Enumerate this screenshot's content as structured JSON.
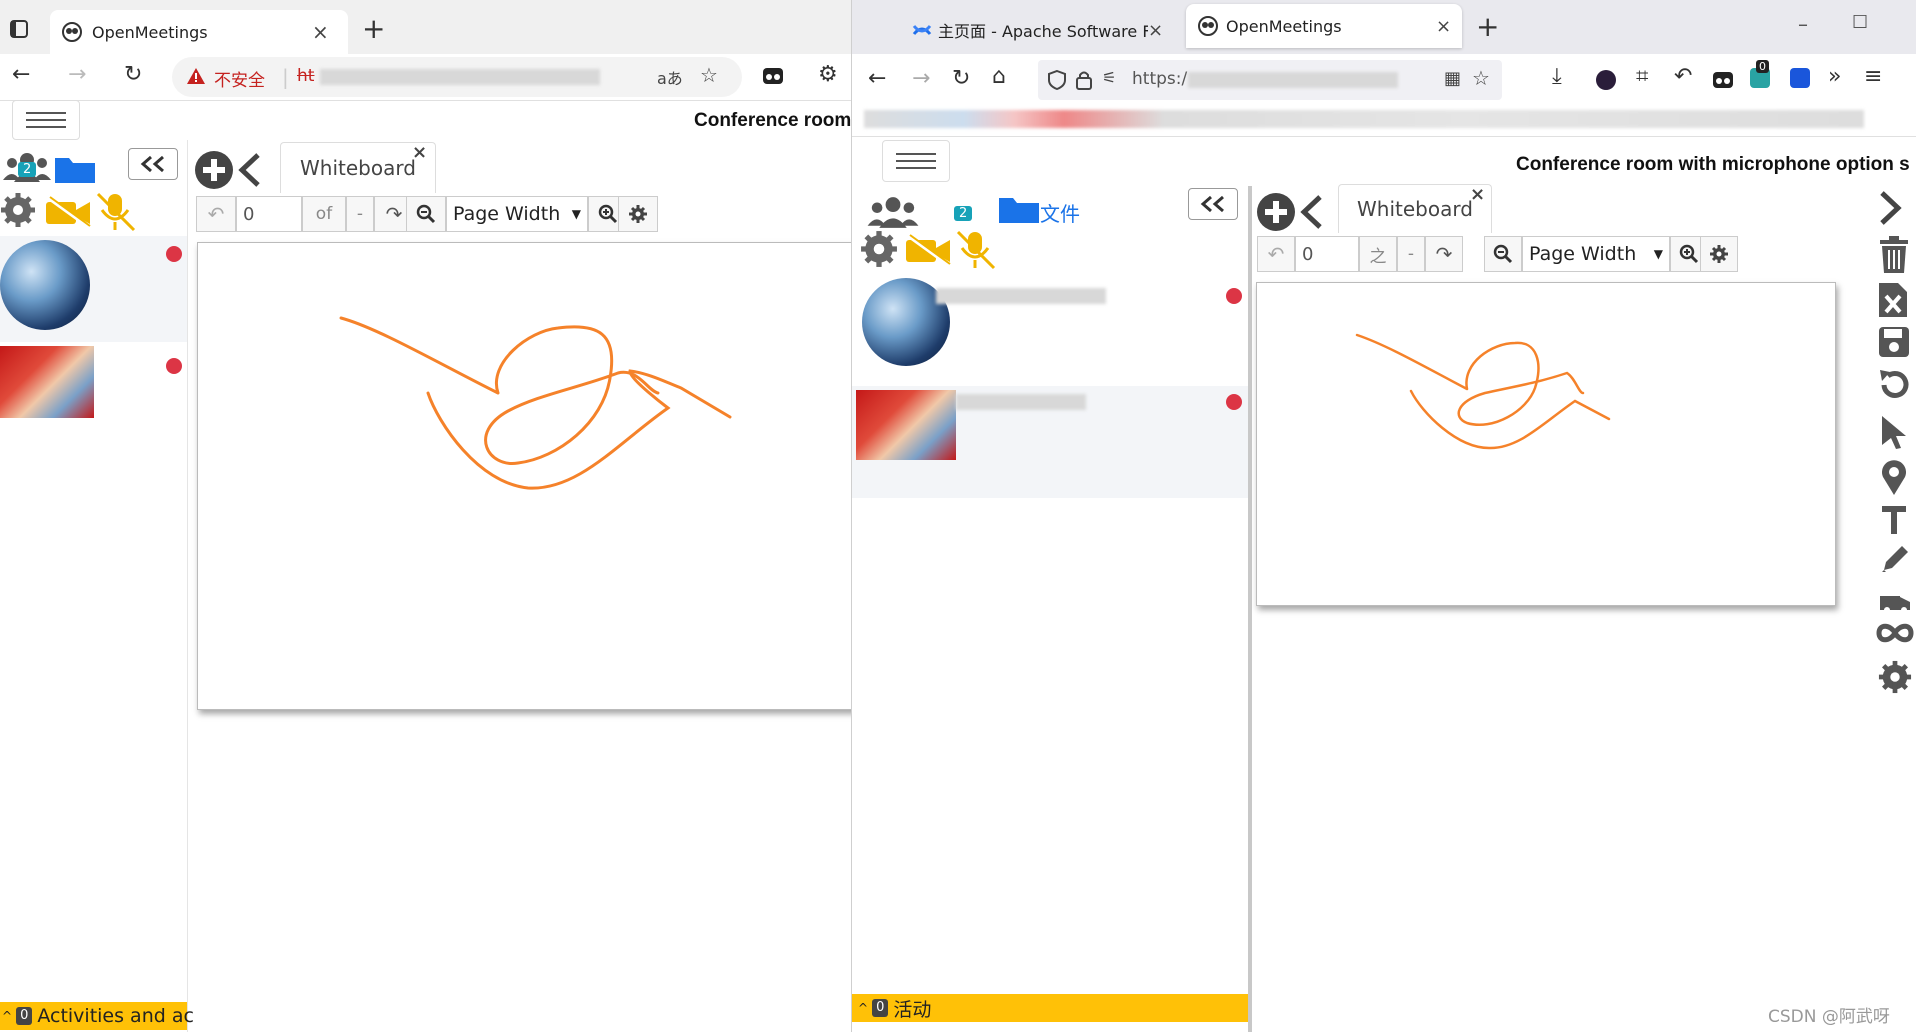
{
  "left_window": {
    "tab_title": "OpenMeetings",
    "new_tab": "+",
    "close_tab": "×",
    "security_warning": "不安全",
    "url_prefix": "ht",
    "translate_glyph": "aあ",
    "room_title": "Conference room",
    "participants_count": "2",
    "page_input": "0",
    "of_label": "of",
    "dash": "-",
    "zoom_select": "Page Width",
    "tab_label": "Whiteboard",
    "tab_close": "×",
    "activities_count": "0",
    "activities_label": "Activities and ac"
  },
  "right_window": {
    "tab1_title": "主页面 - Apache Software Fo",
    "tab2_title": "OpenMeetings",
    "new_tab": "+",
    "close_tab": "×",
    "url_prefix": "https:/",
    "ext_badge": "0",
    "room_title": "Conference room with microphone option s",
    "participants_count": "2",
    "files_label": "文件",
    "page_input": "0",
    "of_label": "之",
    "dash": "-",
    "zoom_select": "Page Width",
    "tab_label": "Whiteboard",
    "tab_close": "×",
    "activities_count": "0",
    "activities_label": "活动"
  },
  "watermark": "CSDN @阿武呀",
  "colors": {
    "stroke": "#f5822a",
    "activities_bar": "#ffc107",
    "blue_icon": "#1a73e8",
    "warning_red": "#c5221f",
    "mute_yellow": "#f0b400",
    "status_red": "#dc3545"
  },
  "icons": [
    "menu-icon",
    "users-icon",
    "folder-icon",
    "gear-icon",
    "camera-off-icon",
    "mic-off-icon",
    "plus-icon",
    "chevron-left-icon",
    "undo-icon",
    "redo-icon",
    "zoom-out-icon",
    "zoom-in-icon",
    "trash-icon",
    "excel-icon",
    "save-icon",
    "reload-icon",
    "pointer-icon",
    "pin-icon",
    "text-icon",
    "pen-icon",
    "shapes-icon",
    "infinity-icon"
  ]
}
